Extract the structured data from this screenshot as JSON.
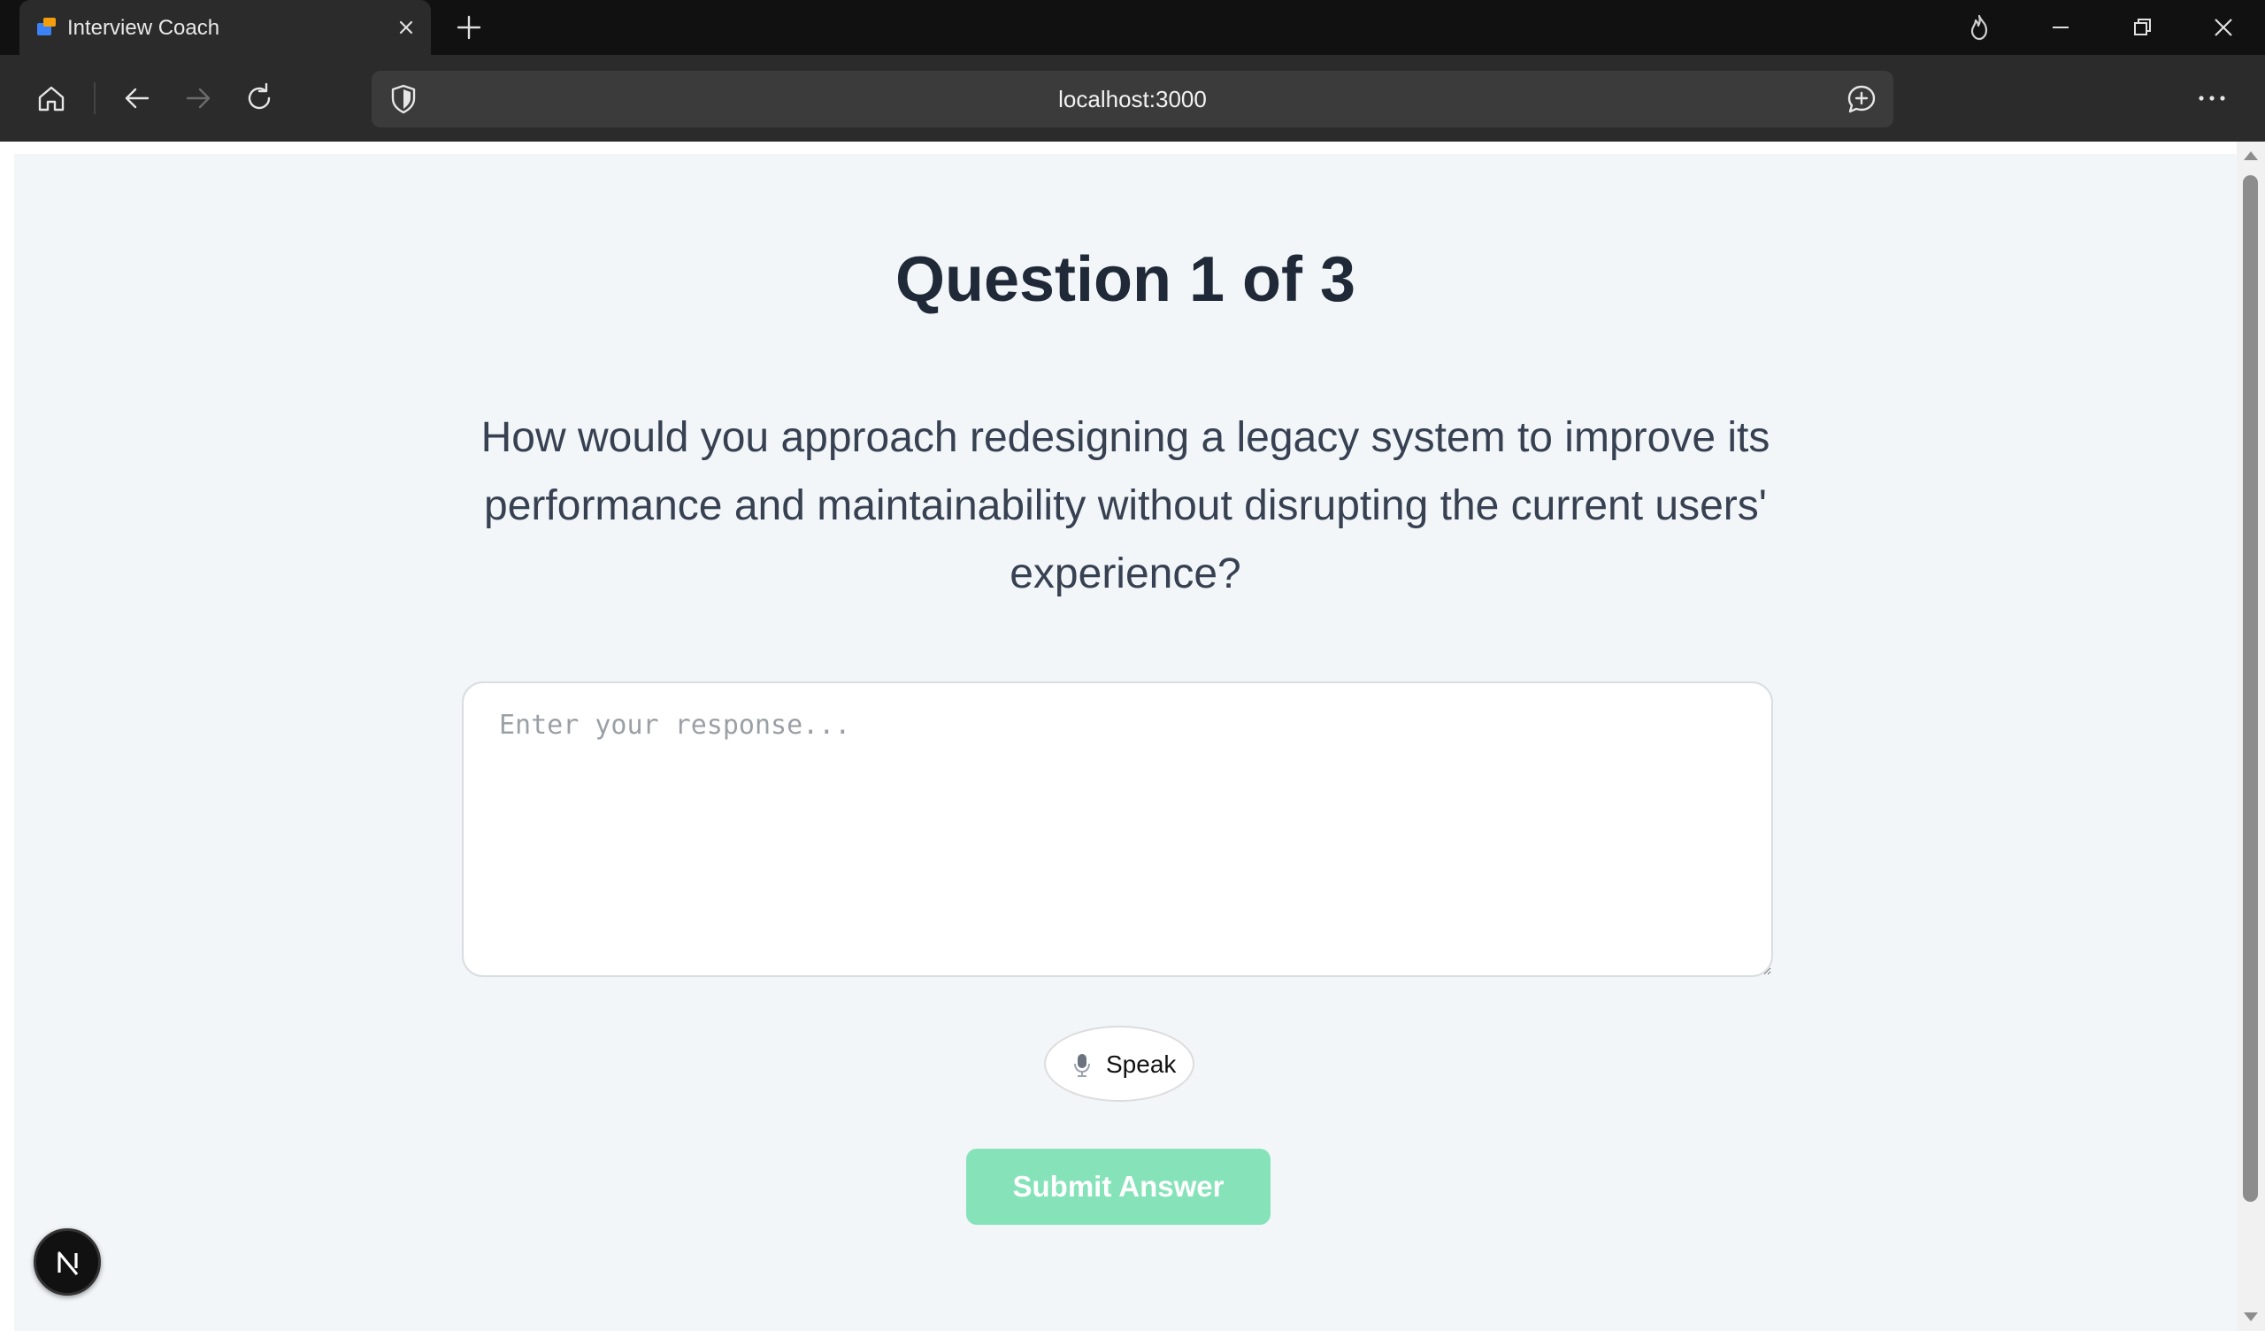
{
  "browser": {
    "tab_title": "Interview Coach",
    "url": "localhost:3000"
  },
  "page": {
    "heading": "Question 1 of 3",
    "question": "How would you approach redesigning a legacy system to improve its performance and maintainability without disrupting the current users' experience?",
    "answer_placeholder": "Enter your response...",
    "answer_value": "",
    "speak_label": "Speak",
    "submit_label": "Submit Answer",
    "badge_letter": "N"
  },
  "colors": {
    "page_background": "#f2f6f9",
    "heading_text": "#1f2937",
    "body_text": "#374151",
    "submit_background": "#86e3b9",
    "browser_frame": "#111111",
    "browser_toolbar": "#2b2b2b"
  },
  "icons": {
    "favicon": "app-favicon-icon",
    "tab_close": "close-icon",
    "new_tab": "plus-icon",
    "flame": "flame-icon",
    "minimize": "minimize-icon",
    "restore": "restore-icon",
    "close_window": "close-window-icon",
    "home": "home-icon",
    "back": "arrow-left-icon",
    "forward": "arrow-right-icon",
    "reload": "reload-icon",
    "shield": "shield-icon",
    "chat": "chat-plus-icon",
    "menu": "more-dots-icon",
    "microphone": "microphone-icon"
  }
}
